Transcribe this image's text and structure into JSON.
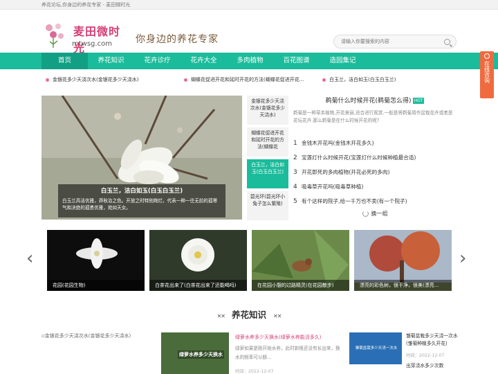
{
  "topbar": {
    "text": "养花论坛,你身边的养花专家 - 麦田微时光"
  },
  "header": {
    "logo_name": "麦田微时光",
    "logo_domain": "mtwsg.com",
    "slogan": "你身边的养花专家",
    "search_placeholder": "请输入你要搜索的内容"
  },
  "nav": {
    "items": [
      "首页",
      "养花知识",
      "花卉诊疗",
      "花卉大全",
      "多肉植物",
      "百花图谱",
      "造园集记"
    ]
  },
  "ticker": [
    "金银花多少天浇次水(金银花多少天浇水)",
    "蝴蝶花促进开花和延时开花的方法(蝴蝶花促进开花...",
    "白玉兰，洁白如玉(白玉白玉兰)"
  ],
  "banner": {
    "title": "白玉兰，洁白如玉(白玉白玉兰)",
    "desc": "白玉兰高洁优雅，莽秋治之色。开放之时特别绚烂，代表一种一往无前的孤寒气和决绝的孤勇优雅，宛如天女。"
  },
  "thumbs": [
    "金银花多少天浇次水(金银花多少天浇水)",
    "蝴蝶花促进开花和延时开花的方法(蝴蝶花",
    "白玉兰，洁白如玉(白玉白玉兰)",
    "碧光环(碧光环小兔子怎么繁殖)"
  ],
  "hot": {
    "title": "鹈菊什么时候开花(鹈菊怎么得)",
    "badge": "HOT",
    "desc": "鹈菊是一种草本植物,开花美丽,适合进行观赏.一般是将鹈菊用作盆栽花卉或者是花坛花卉.那么鹈菊是在什么时候开花的呢?",
    "list": [
      {
        "n": "1",
        "t": "金钱木开花吗(金钱木开花多久)"
      },
      {
        "n": "2",
        "t": "宝莲灯什么时候开花(宝莲灯什么时候种植最合适)"
      },
      {
        "n": "3",
        "t": "开花即死的多肉植物(开花必死的多肉)"
      },
      {
        "n": "4",
        "t": "吸毒草开花吗(吸毒草种植)"
      },
      {
        "n": "5",
        "t": "有个这样的院子,给一千万也不卖(有一个院子)"
      }
    ],
    "change": "换一组"
  },
  "carousel": [
    "花园(花园生物)",
    "白茶花出来了(白茶花出来了还能喝吗)",
    "在花园小憩的过路精灵(在花园散步)",
    "漂亮的彩色树，很干净，很美(漂亮..."
  ],
  "section": {
    "title": "养花知识",
    "deco_left": "✕✕",
    "deco_right": "✕✕"
  },
  "news": {
    "first_alt": "金银花多少天浇次水(金银花多少天浇水)",
    "img_text": "绿萝水养多少天换水",
    "article": {
      "title": "绿萝水养多少天换水(绿萝水养能活多久)",
      "desc": "绿萝如果是刚开始水养，此时新根还没有长出来，换水的频率可以额...",
      "time": "时间：2022-12-07"
    },
    "img3_text": "雏菊盆栽多少天浇一次水",
    "side": {
      "title": "雏菊盆栽多少天浇一次水(雏菊种植多久开花)",
      "time": "时间：2022-12-07",
      "next": "出芽浇水多少次数"
    }
  },
  "consult": {
    "label": "在线咨询"
  },
  "colors": {
    "accent": "#1bbc9b",
    "brand": "#d43f75",
    "consult": "#ef6b3f"
  }
}
